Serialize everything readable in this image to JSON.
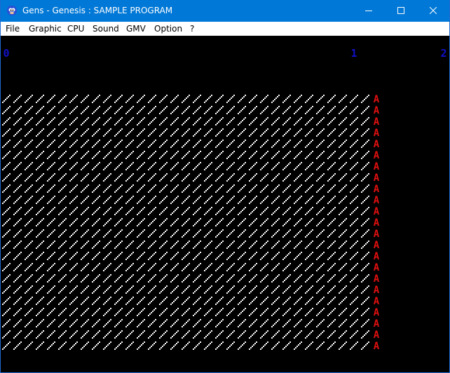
{
  "window": {
    "title": "Gens - Genesis : SAMPLE PROGRAM",
    "icon": "gens-sonic-icon",
    "controls": [
      "minimize-icon",
      "maximize-icon",
      "close-icon"
    ]
  },
  "menu": {
    "items": [
      "File",
      "Graphic",
      "CPU",
      "Sound",
      "GMV",
      "Option",
      "?"
    ]
  },
  "screen": {
    "background": "#000000",
    "ruler_digits": [
      "0",
      "1",
      "2"
    ],
    "ruler_color": "#1010c8",
    "pattern_glyph": "diagonal-slash",
    "pattern_color": "#ffffff",
    "edge_glyph": "A",
    "edge_color": "#e01010",
    "pattern_columns": 33,
    "pattern_rows": 23
  },
  "colors": {
    "titlebar": "#0078d7",
    "menubar": "#ffffff"
  }
}
